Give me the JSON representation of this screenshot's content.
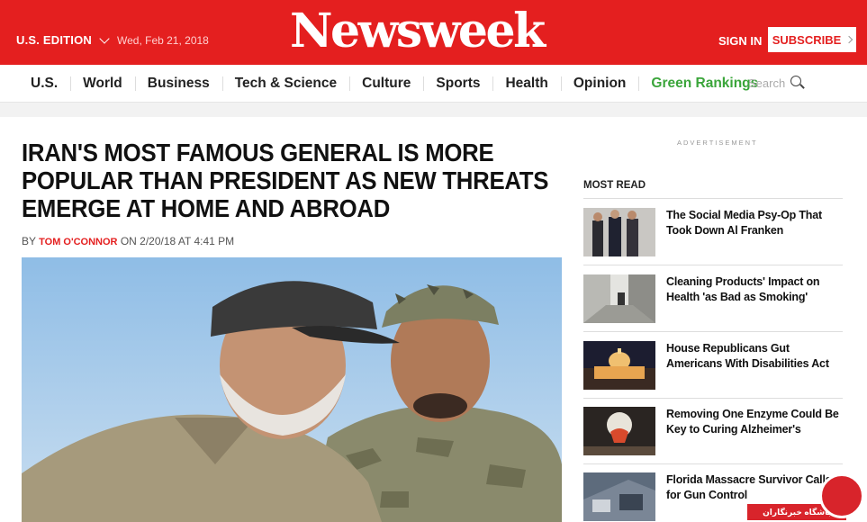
{
  "header": {
    "edition": "U.S. EDITION",
    "date": "Wed, Feb 21, 2018",
    "logo": "Newsweek",
    "sign_in": "SIGN IN",
    "subscribe": "SUBSCRIBE",
    "brand_color": "#e41f1f"
  },
  "nav": {
    "items": [
      "U.S.",
      "World",
      "Business",
      "Tech & Science",
      "Culture",
      "Sports",
      "Health",
      "Opinion",
      "Green Rankings"
    ],
    "search_placeholder": "Search",
    "highlight_color": "#3aa53a"
  },
  "article": {
    "headline": "IRAN'S MOST FAMOUS GENERAL IS MORE POPULAR THAN PRESIDENT AS NEW THREATS EMERGE AT HOME AND ABROAD",
    "by": "BY",
    "author": "TOM O'CONNOR",
    "timestamp": "ON 2/20/18 AT 4:41 PM"
  },
  "sidebar": {
    "ad_label": "ADVERTISEMENT",
    "most_read_label": "MOST READ",
    "items": [
      {
        "title": "The Social Media Psy-Op That Took Down Al Franken"
      },
      {
        "title": "Cleaning Products' Impact on Health 'as Bad as Smoking'"
      },
      {
        "title": "House Republicans Gut Americans With Disabilities Act"
      },
      {
        "title": "Removing One Enzyme Could Be Key to Curing Alzheimer's"
      },
      {
        "title": "Florida Massacre Survivor Calls for Gun Control"
      }
    ]
  },
  "watermark": {
    "text": "باشگاه خبرنگاران"
  }
}
